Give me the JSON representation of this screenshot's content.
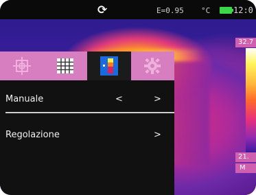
{
  "status_bar": {
    "rotate_icon": "rotate-icon",
    "emissivity": "E=0.95",
    "unit": "°C",
    "battery_icon": "battery-icon",
    "time": "12:0"
  },
  "scale": {
    "max": "32.7",
    "min": "21.",
    "mode": "M"
  },
  "tabs": [
    {
      "name": "crosshair",
      "icon": "crosshair-icon",
      "active": false
    },
    {
      "name": "grid",
      "icon": "grid-icon",
      "active": false
    },
    {
      "name": "palette",
      "icon": "palette-icon",
      "active": true
    },
    {
      "name": "settings",
      "icon": "gear-icon",
      "active": false
    }
  ],
  "menu": {
    "row1": {
      "label": "Manuale",
      "left_arrow": "<",
      "right_arrow": ">"
    },
    "row2": {
      "label": "Regolazione",
      "right_arrow": ">"
    }
  },
  "colors": {
    "tab_bar": "#d67ec0",
    "scale_label": "#d15fb0",
    "battery": "#3bd84a"
  }
}
